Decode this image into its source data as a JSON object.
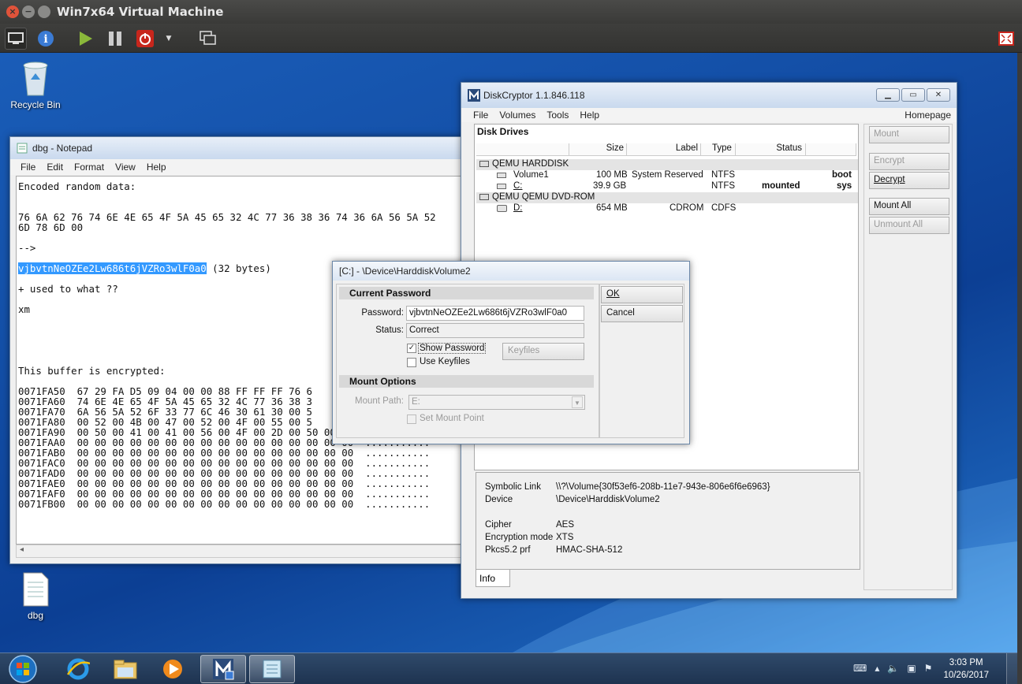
{
  "host": {
    "title": "Win7x64 Virtual Machine",
    "traffic_close": "×",
    "traffic_min": "−"
  },
  "desktop": {
    "icons": [
      {
        "label": "Recycle Bin",
        "icon": "recycle-bin-icon"
      },
      {
        "label": "dbg",
        "icon": "text-file-icon"
      }
    ]
  },
  "notepad": {
    "title": "dbg - Notepad",
    "menu": [
      "File",
      "Edit",
      "Format",
      "View",
      "Help"
    ],
    "lines": [
      "Encoded random data:",
      "",
      "",
      "76 6A 62 76 74 6E 4E 65 4F 5A 45 65 32 4C 77 36 38 36 74 36 6A 56 5A 52",
      "6D 78 6D 00",
      "",
      "-->",
      ""
    ],
    "selected_text": "vjbvtnNeOZEe2Lw686t6jVZRo3wlF0a0",
    "selected_suffix": " (32 bytes)",
    "lines_after": [
      "",
      "+ used to what ??",
      "",
      "xm",
      "",
      "",
      "",
      "",
      "",
      "This buffer is encrypted:",
      "",
      "0071FA50  67 29 FA D5 09 04 00 00 88 FF FF FF 76 6",
      "0071FA60  74 6E 4E 65 4F 5A 45 65 32 4C 77 36 38 3",
      "0071FA70  6A 56 5A 52 6F 33 77 6C 46 30 61 30 00 5",
      "0071FA80  00 52 00 4B 00 47 00 52 00 4F 00 55 00 5",
      "0071FA90  00 50 00 41 00 41 00 56 00 4F 00 2D 00 50 00 45  .P.A.A.V.O.",
      "0071FAA0  00 00 00 00 00 00 00 00 00 00 00 00 00 00 00 00  ...........",
      "0071FAB0  00 00 00 00 00 00 00 00 00 00 00 00 00 00 00 00  ...........",
      "0071FAC0  00 00 00 00 00 00 00 00 00 00 00 00 00 00 00 00  ...........",
      "0071FAD0  00 00 00 00 00 00 00 00 00 00 00 00 00 00 00 00  ...........",
      "0071FAE0  00 00 00 00 00 00 00 00 00 00 00 00 00 00 00 00  ...........",
      "0071FAF0  00 00 00 00 00 00 00 00 00 00 00 00 00 00 00 00  ...........",
      "0071FB00  00 00 00 00 00 00 00 00 00 00 00 00 00 00 00 00  ..........."
    ],
    "scroll_left": "◂"
  },
  "diskcryptor": {
    "title": "DiskCryptor 1.1.846.118",
    "menu": [
      "File",
      "Volumes",
      "Tools",
      "Help"
    ],
    "homepage": "Homepage",
    "list_title": "Disk Drives",
    "columns": [
      "Size",
      "Label",
      "Type",
      "Status"
    ],
    "groups": [
      {
        "name": "QEMU HARDDISK"
      },
      {
        "name": "QEMU QEMU DVD-ROM"
      }
    ],
    "volumes": [
      {
        "name": "Volume1",
        "size": "100 MB",
        "label": "System Reserved",
        "type": "NTFS",
        "status": "",
        "flag": "boot"
      },
      {
        "name": "C:",
        "size": "39.9 GB",
        "label": "",
        "type": "NTFS",
        "status": "mounted",
        "flag": "sys"
      },
      {
        "name": "D:",
        "size": "654 MB",
        "label": "CDROM",
        "type": "CDFS",
        "status": "",
        "flag": ""
      }
    ],
    "buttons": {
      "mount": "Mount",
      "encrypt": "Encrypt",
      "decrypt": "Decrypt",
      "mount_all": "Mount All",
      "unmount_all": "Unmount All"
    },
    "info": {
      "symbolic_link_label": "Symbolic Link",
      "symbolic_link": "\\\\?\\Volume{30f53ef6-208b-11e7-943e-806e6f6e6963}",
      "device_label": "Device",
      "device": "\\Device\\HarddiskVolume2",
      "cipher_label": "Cipher",
      "cipher": "AES",
      "mode_label": "Encryption mode",
      "mode": "XTS",
      "prf_label": "Pkcs5.2 prf",
      "prf": "HMAC-SHA-512"
    },
    "tab": "Info"
  },
  "dialog": {
    "title": "[C:] - \\Device\\HarddiskVolume2",
    "current_password_header": "Current Password",
    "password_label": "Password:",
    "password_value": "vjbvtnNeOZEe2Lw686t6jVZRo3wlF0a0",
    "status_label": "Status:",
    "status_value": "Correct",
    "show_password": "Show Password",
    "keyfiles": "Keyfiles",
    "use_keyfiles": "Use Keyfiles",
    "mount_options_header": "Mount Options",
    "mount_path_label": "Mount Path:",
    "mount_path_value": "E:",
    "set_mount_point": "Set Mount Point",
    "ok": "OK",
    "cancel": "Cancel"
  },
  "taskbar": {
    "time": "3:03 PM",
    "date": "10/26/2017"
  }
}
